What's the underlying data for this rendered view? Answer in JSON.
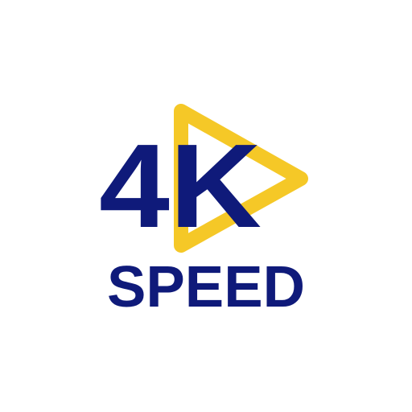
{
  "logo": {
    "primary_text": "4K",
    "secondary_text": "SPEED",
    "colors": {
      "text": "#0f1a7a",
      "play_icon": "#f5c827",
      "background": "#ffffff"
    },
    "icon": "play-triangle-icon"
  }
}
